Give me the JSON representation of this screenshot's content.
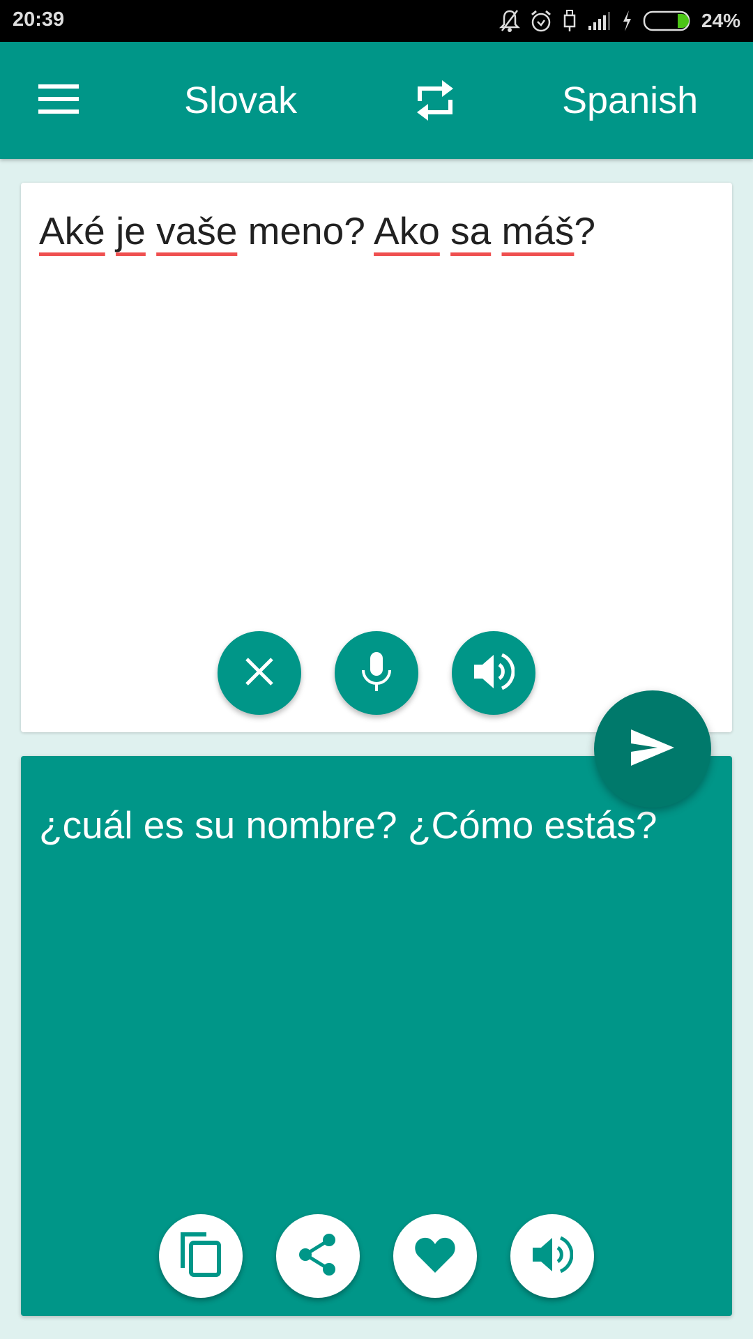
{
  "status_bar": {
    "time": "20:39",
    "battery_percent": "24%",
    "battery_level": 0.24,
    "icons": [
      "bell-off-icon",
      "alarm-icon",
      "usb-icon",
      "signal-icon",
      "charging-icon",
      "battery-icon"
    ]
  },
  "app_bar": {
    "menu_icon": "hamburger-menu-icon",
    "source_language": "Slovak",
    "swap_icon": "swap-languages-icon",
    "target_language": "Spanish"
  },
  "input": {
    "words": [
      {
        "text": "Aké",
        "misspelled": true
      },
      {
        "text": " ",
        "misspelled": false
      },
      {
        "text": "je",
        "misspelled": true
      },
      {
        "text": " ",
        "misspelled": false
      },
      {
        "text": "vaše",
        "misspelled": true
      },
      {
        "text": " meno? ",
        "misspelled": false
      },
      {
        "text": "Ako",
        "misspelled": true
      },
      {
        "text": " ",
        "misspelled": false
      },
      {
        "text": "sa",
        "misspelled": true
      },
      {
        "text": " ",
        "misspelled": false
      },
      {
        "text": "máš",
        "misspelled": true
      },
      {
        "text": "?",
        "misspelled": false
      }
    ],
    "text": "Aké je vaše meno? Ako sa máš?",
    "buttons": [
      {
        "name": "clear",
        "icon": "close-icon"
      },
      {
        "name": "microphone",
        "icon": "microphone-icon"
      },
      {
        "name": "speak-input",
        "icon": "speaker-icon"
      }
    ]
  },
  "send_button": {
    "icon": "send-icon"
  },
  "output": {
    "text": "¿cuál es su nombre? ¿Cómo estás?",
    "buttons": [
      {
        "name": "copy",
        "icon": "copy-icon"
      },
      {
        "name": "share",
        "icon": "share-icon"
      },
      {
        "name": "favorite",
        "icon": "heart-icon"
      },
      {
        "name": "speak-output",
        "icon": "speaker-icon"
      }
    ]
  },
  "colors": {
    "primary": "#009688",
    "primary_dark": "#00796B",
    "background": "#DFF1EF",
    "spellcheck_underline": "#EF4F4F"
  }
}
